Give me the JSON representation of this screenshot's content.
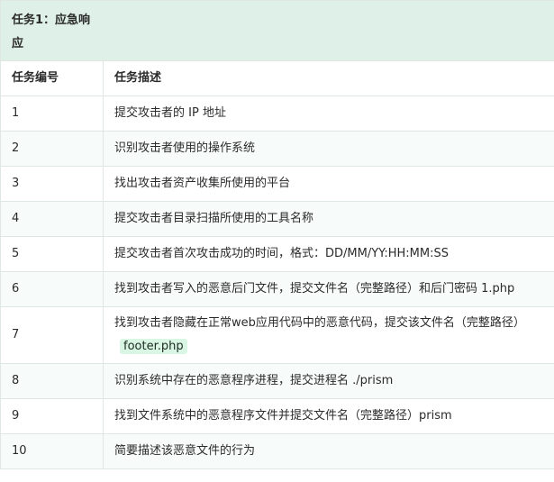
{
  "table": {
    "title": "任务1：应急响应",
    "columns": [
      "任务编号",
      "任务描述"
    ],
    "rows": [
      {
        "id": "1",
        "desc": "提交攻击者的 IP 地址"
      },
      {
        "id": "2",
        "desc": "识别攻击者使用的操作系统"
      },
      {
        "id": "3",
        "desc": "找出攻击者资产收集所使用的平台"
      },
      {
        "id": "4",
        "desc": "提交攻击者目录扫描所使用的工具名称"
      },
      {
        "id": "5",
        "desc": "提交攻击者首次攻击成功的时间，格式：DD/MM/YY:HH:MM:SS"
      },
      {
        "id": "6",
        "desc": "找到攻击者写入的恶意后门文件，提交文件名（完整路径）和后门密码 1.php"
      },
      {
        "id": "7",
        "desc": "找到攻击者隐藏在正常web应用代码中的恶意代码，提交该文件名（完整路径）",
        "code": "footer.php"
      },
      {
        "id": "8",
        "desc": "识别系统中存在的恶意程序进程，提交进程名 ./prism"
      },
      {
        "id": "9",
        "desc": "找到文件系统中的恶意程序文件并提交文件名（完整路径）prism"
      },
      {
        "id": "10",
        "desc": "简要描述该恶意文件的行为"
      }
    ]
  }
}
